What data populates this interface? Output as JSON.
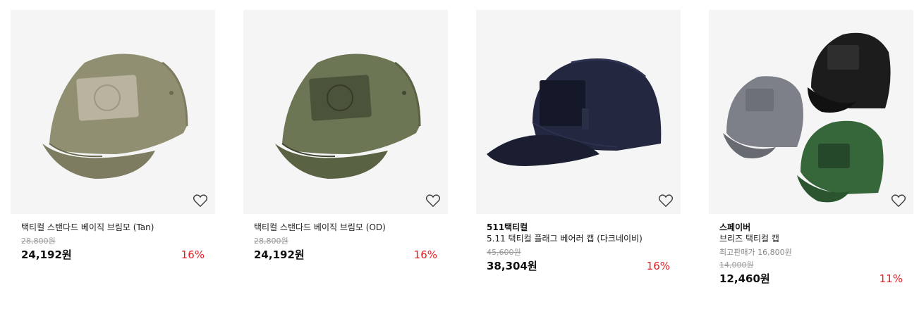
{
  "products": [
    {
      "brand": "",
      "name": "택티컬 스탠다드 베이직 브림모 (Tan)",
      "best_price": "",
      "original_price": "28,800원",
      "price": "24,192원",
      "discount": "16%",
      "cap_color": "#8f9172",
      "icon": "heart-icon"
    },
    {
      "brand": "",
      "name": "택티컬 스탠다드 베이직 브림모 (OD)",
      "best_price": "",
      "original_price": "28,800원",
      "price": "24,192원",
      "discount": "16%",
      "cap_color": "#66704f",
      "icon": "heart-icon"
    },
    {
      "brand": "511택티컬",
      "name": "5.11 택티컬 플래그 베어러 캡 (다크네이비)",
      "best_price": "",
      "original_price": "45,600원",
      "price": "38,304원",
      "discount": "16%",
      "cap_color": "#1f2438",
      "icon": "heart-icon"
    },
    {
      "brand": "스페이버",
      "name": "브리즈 택티컬 캡",
      "best_price": "최고판매가 16,800원",
      "original_price": "14,000원",
      "price": "12,460원",
      "discount": "11%",
      "cap_color": "#2e5c30",
      "icon": "heart-icon"
    }
  ],
  "colors": {
    "discount": "#e31e24",
    "thumb_bg": "#f5f5f5"
  }
}
